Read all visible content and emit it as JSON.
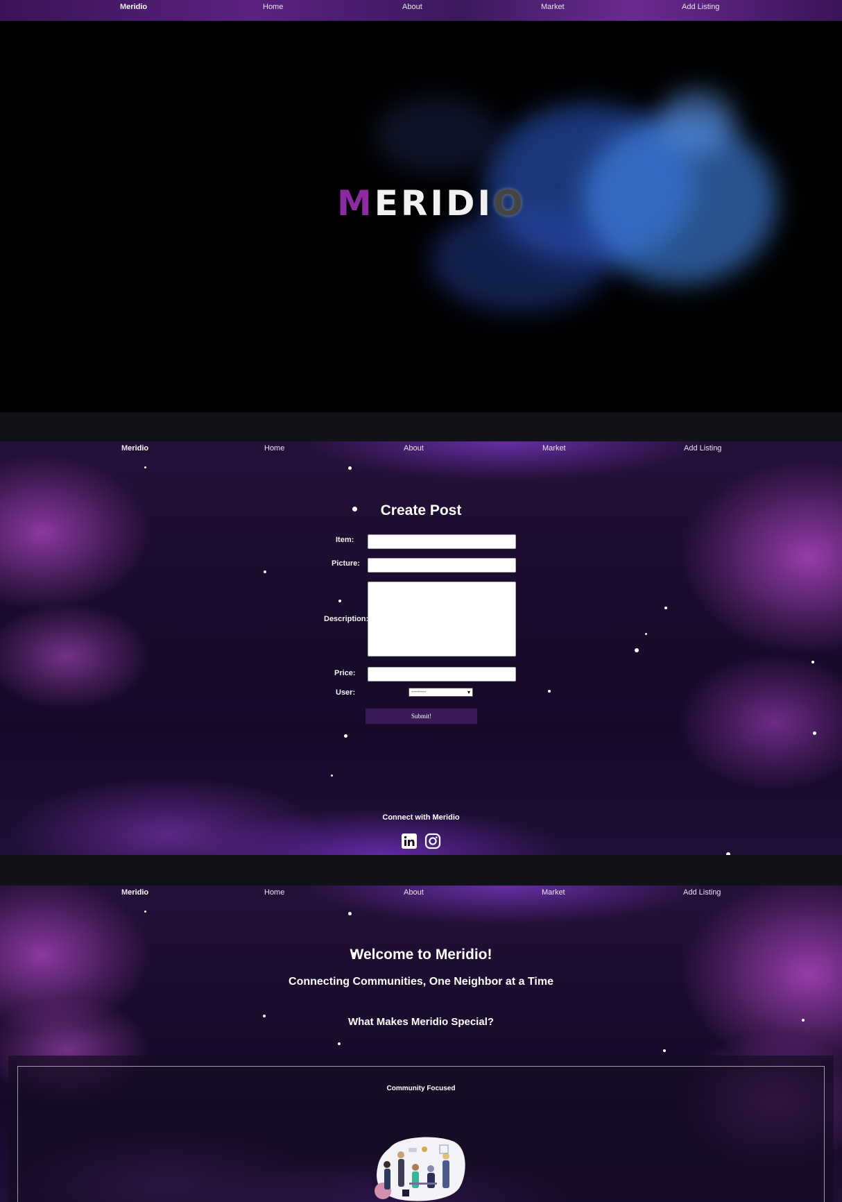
{
  "nav": {
    "brand_first": "M",
    "brand_rest": "eridio",
    "home": "Home",
    "about": "About",
    "market": "Market",
    "add_listing": "Add Listing"
  },
  "hero": {
    "title_first": "M",
    "title_mid": "ERIDI",
    "title_last": "O"
  },
  "create_post": {
    "title": "Create Post",
    "item_label": "Item:",
    "picture_label": "Picture:",
    "description_label": "Description:",
    "price_label": "Price:",
    "user_label": "User:",
    "user_selected": "---------",
    "submit_label": "Submit!",
    "connect_text": "Connect with Meridio",
    "social_icons": [
      "linkedin-icon",
      "instagram-icon"
    ]
  },
  "welcome": {
    "title": "Welcome to Meridio!",
    "subtitle": "Connecting Communities, One Neighbor at a Time",
    "special_heading": "What Makes Meridio Special?",
    "feature_title": "Community Focused"
  },
  "colors": {
    "brand_accent": "#c46cf0",
    "hero_m": "#8d2aa3",
    "submit_bg": "#3a1a56",
    "page_bg": "#101217"
  }
}
